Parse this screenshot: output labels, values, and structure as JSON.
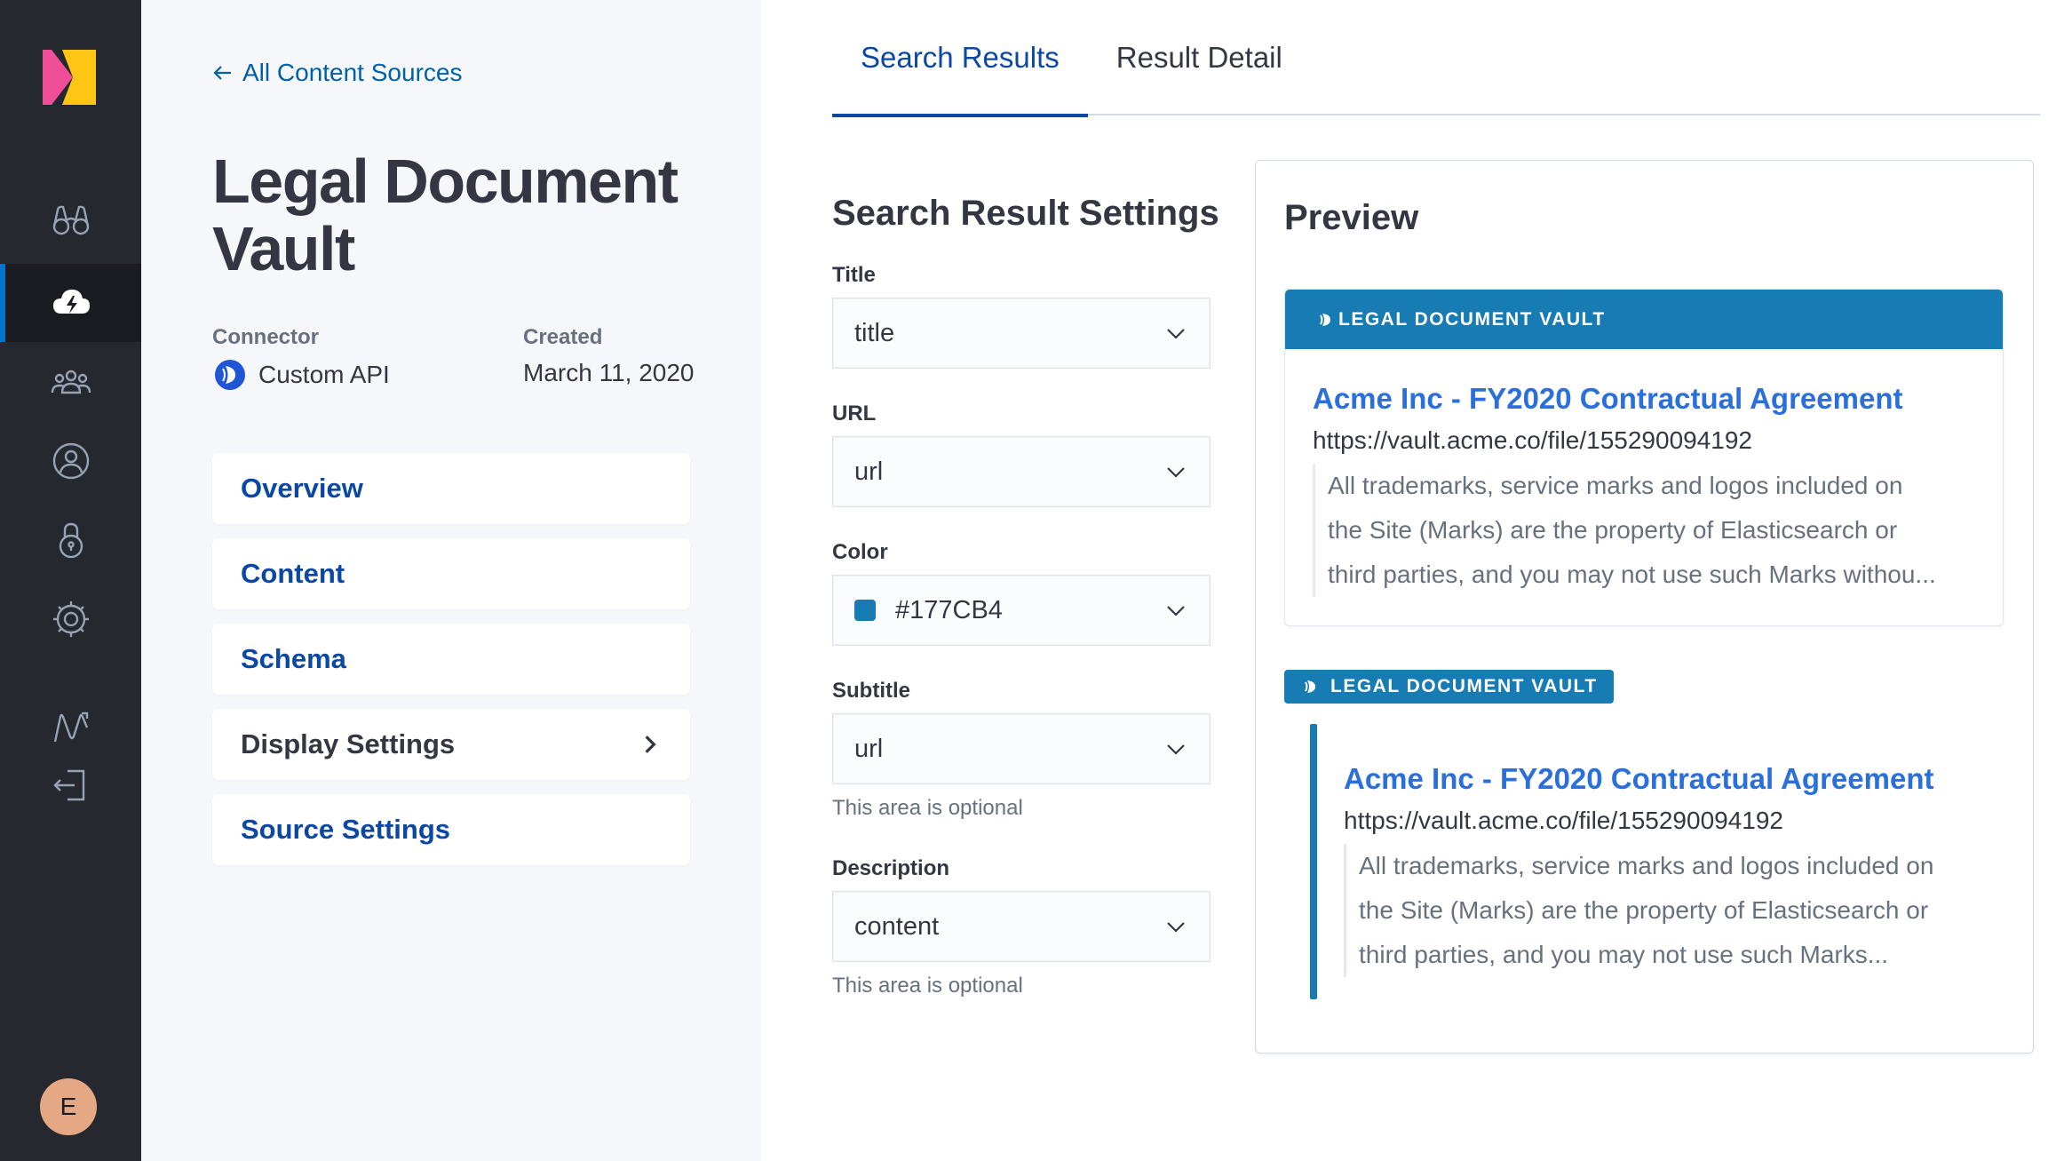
{
  "colors": {
    "accent": "#177CB4",
    "rail_bg": "#25282f",
    "link": "#0b47a5",
    "result_title": "#2a6fdb"
  },
  "rail": {
    "items": [
      {
        "name": "binoculars-icon",
        "active": false
      },
      {
        "name": "cloud-bolt-icon",
        "active": true
      },
      {
        "name": "users-group-icon",
        "active": false
      },
      {
        "name": "user-circle-icon",
        "active": false
      },
      {
        "name": "lock-icon",
        "active": false
      },
      {
        "name": "gear-icon",
        "active": false
      },
      {
        "name": "analytics-icon",
        "active": false
      },
      {
        "name": "logout-icon",
        "active": false
      }
    ],
    "avatar_initial": "E"
  },
  "sidebar": {
    "back_link": "All Content Sources",
    "source_title": "Legal Document Vault",
    "connector_label": "Connector",
    "connector_value": "Custom API",
    "created_label": "Created",
    "created_value": "March 11, 2020",
    "nav": [
      {
        "label": "Overview",
        "style": "link"
      },
      {
        "label": "Content",
        "style": "link"
      },
      {
        "label": "Schema",
        "style": "link"
      },
      {
        "label": "Display Settings",
        "style": "plain",
        "chevron": true
      },
      {
        "label": "Source Settings",
        "style": "link"
      }
    ]
  },
  "tabs": [
    {
      "label": "Search Results",
      "active": true
    },
    {
      "label": "Result Detail",
      "active": false
    }
  ],
  "settings": {
    "title": "Search Result Settings",
    "fields": {
      "title": {
        "label": "Title",
        "value": "title"
      },
      "url": {
        "label": "URL",
        "value": "url"
      },
      "color": {
        "label": "Color",
        "value": "#177CB4"
      },
      "subtitle": {
        "label": "Subtitle",
        "value": "url",
        "help": "This area is optional"
      },
      "description": {
        "label": "Description",
        "value": "content",
        "help": "This area is optional"
      }
    }
  },
  "preview": {
    "title": "Preview",
    "source_badge": "LEGAL DOCUMENT VAULT",
    "card1": {
      "title": "Acme Inc - FY2020 Contractual Agreement",
      "url": "https://vault.acme.co/file/155290094192",
      "desc_lines": [
        "All trademarks, service marks and logos included on",
        "the Site (Marks) are the property of Elasticsearch or",
        "third parties, and you may not use such Marks withou..."
      ]
    },
    "card2": {
      "title": "Acme Inc - FY2020 Contractual Agreement",
      "url": "https://vault.acme.co/file/155290094192",
      "desc_lines": [
        "All trademarks, service marks and logos included on",
        "the Site (Marks) are the property of Elasticsearch or",
        "third parties, and you may not use such Marks..."
      ]
    }
  }
}
